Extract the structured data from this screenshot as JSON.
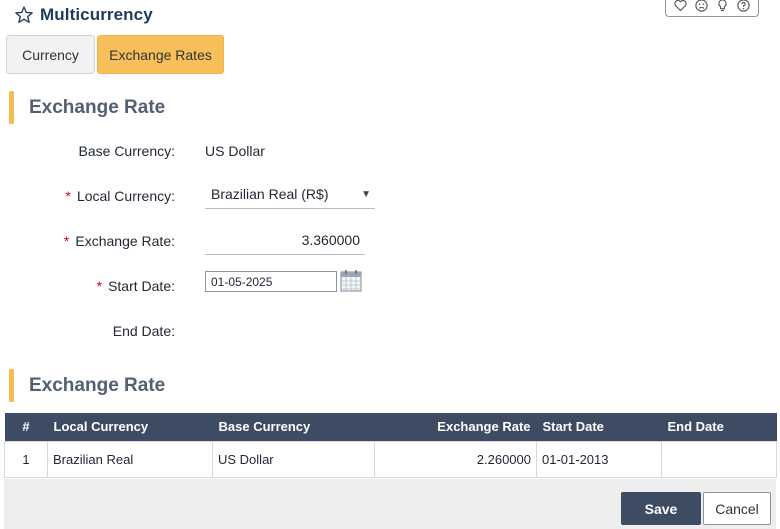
{
  "header": {
    "title": "Multicurrency",
    "icons": [
      "star-icon",
      "heart-icon",
      "sad-face-icon",
      "lightbulb-icon",
      "help-icon"
    ]
  },
  "tabs": [
    {
      "label": "Currency",
      "active": false
    },
    {
      "label": "Exchange Rates",
      "active": true
    }
  ],
  "form": {
    "section_title": "Exchange Rate",
    "base_currency": {
      "label": "Base Currency:",
      "value": "US Dollar"
    },
    "local_currency": {
      "label": "Local Currency:",
      "value": "Brazilian Real (R$)",
      "required": true
    },
    "exchange_rate": {
      "label": "Exchange Rate:",
      "value": "3.360000",
      "required": true
    },
    "start_date": {
      "label": "Start Date:",
      "value": "01-05-2025",
      "required": true
    },
    "end_date": {
      "label": "End Date:",
      "value": ""
    }
  },
  "table": {
    "section_title": "Exchange Rate",
    "columns": [
      "#",
      "Local Currency",
      "Base Currency",
      "Exchange Rate",
      "Start Date",
      "End Date"
    ],
    "rows": [
      [
        "1",
        "Brazilian Real",
        "US Dollar",
        "2.260000",
        "01-01-2013",
        ""
      ]
    ]
  },
  "footer": {
    "save_label": "Save",
    "cancel_label": "Cancel"
  },
  "colors": {
    "accent": "#f7bf5a",
    "header_dark": "#3d4b63",
    "required": "#d0021b"
  }
}
